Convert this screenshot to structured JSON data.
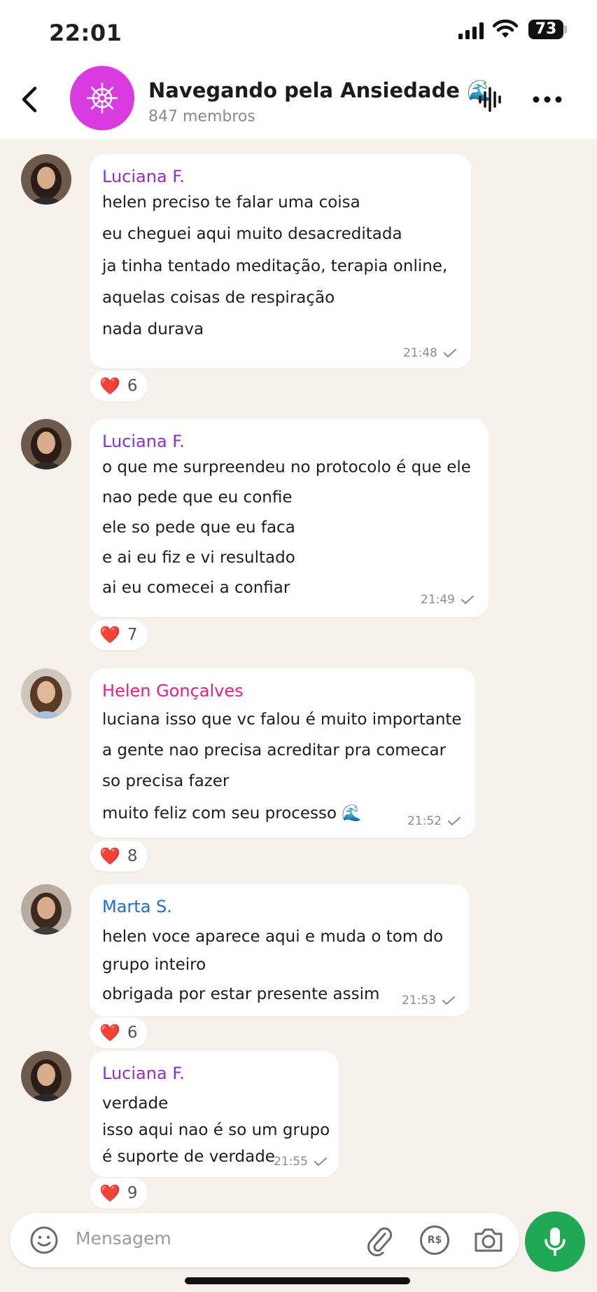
{
  "status": {
    "time": "22:01",
    "battery": "73"
  },
  "header": {
    "title": "Navegando pela Ansiedade 🌊",
    "subtitle": "847 membros"
  },
  "colors": {
    "luciana": "#8e2fd3",
    "helen": "#e3208a",
    "marta": "#1a6ed8",
    "mic": "#1fa855",
    "group_avatar": "#d93be0"
  },
  "messages": [
    {
      "sender": "Luciana F.",
      "lines": [
        "helen preciso te falar uma coisa",
        "eu cheguei aqui muito desacreditada",
        "ja tinha tentado meditação, terapia online,",
        "aquelas coisas de respiração",
        "nada durava"
      ],
      "time": "21:48",
      "reaction": "❤️",
      "reaction_count": "6"
    },
    {
      "sender": "Luciana F.",
      "lines": [
        "o que me surpreendeu no protocolo é que ele",
        "nao pede que eu confie",
        "ele so pede que eu faca",
        "e ai eu fiz e vi resultado",
        "ai eu comecei a confiar"
      ],
      "time": "21:49",
      "reaction": "❤️",
      "reaction_count": "7"
    },
    {
      "sender": "Helen Gonçalves",
      "lines": [
        "luciana isso que vc falou é muito importante",
        "a gente nao precisa acreditar pra comecar",
        "so precisa fazer",
        "muito feliz com seu processo 🌊"
      ],
      "time": "21:52",
      "reaction": "❤️",
      "reaction_count": "8"
    },
    {
      "sender": "Marta S.",
      "lines": [
        "helen voce aparece aqui e muda o tom do",
        "grupo inteiro",
        "obrigada por estar presente assim"
      ],
      "time": "21:53",
      "reaction": "❤️",
      "reaction_count": "6"
    },
    {
      "sender": "Luciana F.",
      "lines": [
        "verdade",
        "isso aqui nao é so um grupo",
        "é suporte de verdade"
      ],
      "time": "21:55",
      "reaction": "❤️",
      "reaction_count": "9"
    }
  ],
  "input": {
    "placeholder": "Mensagem",
    "pay_label": "R$"
  }
}
